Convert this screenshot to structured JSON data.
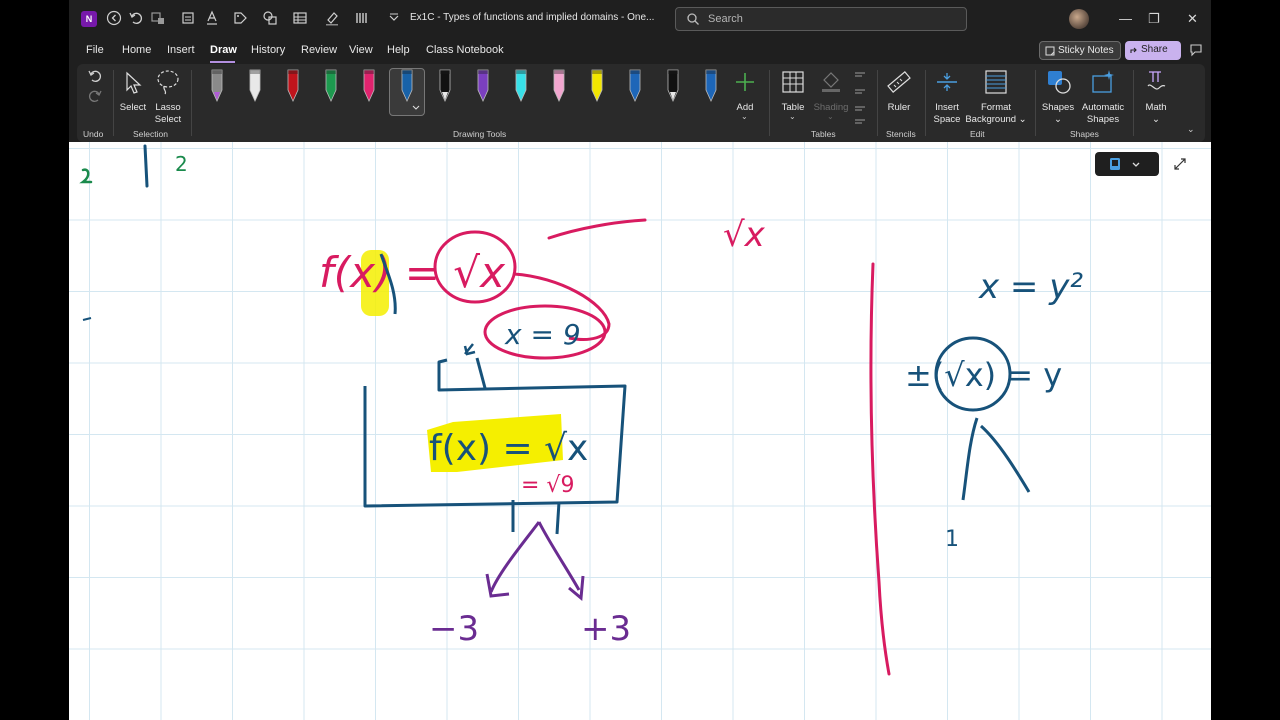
{
  "window": {
    "title": "Ex1C - Types of functions and implied domains  -  One...",
    "app_icon": "N"
  },
  "search": {
    "placeholder": "Search"
  },
  "menu": {
    "tabs": [
      "File",
      "Home",
      "Insert",
      "Draw",
      "History",
      "Review",
      "View",
      "Help",
      "Class Notebook"
    ],
    "active_tab": "Draw",
    "sticky_notes": "Sticky Notes",
    "share": "Share"
  },
  "ribbon": {
    "select": "Select",
    "lasso_select_1": "Lasso",
    "lasso_select_2": "Select",
    "add": "Add",
    "table": "Table",
    "shading": "Shading",
    "ruler": "Ruler",
    "insert_space_1": "Insert",
    "insert_space_2": "Space",
    "format_background_1": "Format",
    "format_background_2": "Background",
    "shapes": "Shapes",
    "automatic_shapes_1": "Automatic",
    "automatic_shapes_2": "Shapes",
    "math": "Math",
    "groups": {
      "undo": "Undo",
      "selection": "Selection",
      "drawing_tools": "Drawing Tools",
      "tables": "Tables",
      "stencils": "Stencils",
      "edit": "Edit",
      "shapes": "Shapes"
    },
    "pens": [
      {
        "color": "#8a8a8a",
        "tip": "#b05bd6"
      },
      {
        "color": "#e8e8e8",
        "tip": "#e8e8e8"
      },
      {
        "color": "#c0141c",
        "tip": "#c0141c"
      },
      {
        "color": "#1d9a4f",
        "tip": "#1d9a4f"
      },
      {
        "color": "#e0236e",
        "tip": "#e0236e"
      },
      {
        "color": "#1862a8",
        "tip": "#1862a8"
      },
      {
        "color": "#111111",
        "tip": "#e8e8e8"
      },
      {
        "color": "#7b3fbf",
        "tip": "#7b3fbf"
      },
      {
        "color": "#38e0e8",
        "tip": "#38e0e8"
      },
      {
        "color": "#f2a6cf",
        "tip": "#f2a6cf"
      },
      {
        "color": "#f2e600",
        "tip": "#f2e600"
      },
      {
        "color": "#1d66b8",
        "tip": "#1d66b8"
      },
      {
        "color": "#111111",
        "tip": "#e8e8e8"
      },
      {
        "color": "#1d66b8",
        "tip": "#1d66b8"
      }
    ]
  },
  "ink": {
    "colors": {
      "blue": "#17527a",
      "pink": "#d81b60",
      "purple": "#6a2c91",
      "green": "#1a8a4c",
      "highlight": "#f5ef00"
    },
    "labels": {
      "top_left": "2",
      "fx_main": "f(x) = √x",
      "fx_box": "f(x) = √x",
      "x_eq_9": "x = 9",
      "sqrt9": "= √9",
      "neg3": "−3",
      "pos3": "+3",
      "sqrtx_top": "√x",
      "x_eq_y2": "x = y²",
      "pm_sqrtx": "±(√x) = y",
      "one": "1"
    }
  }
}
